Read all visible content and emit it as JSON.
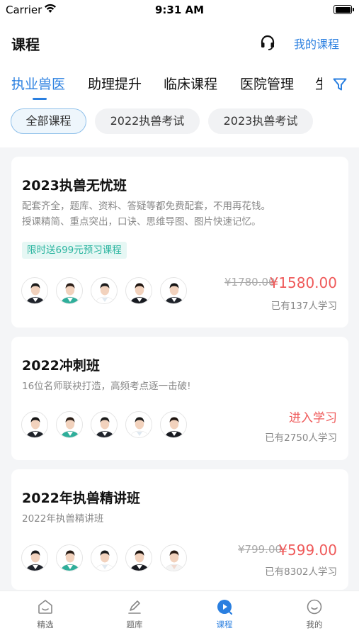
{
  "status_bar": {
    "carrier": "Carrier",
    "time": "9:31 AM"
  },
  "header": {
    "title": "课程",
    "my_courses": "我的课程",
    "support_icon": "headset-icon"
  },
  "tabs": [
    {
      "label": "执业兽医",
      "active": true
    },
    {
      "label": "助理提升",
      "active": false
    },
    {
      "label": "临床课程",
      "active": false
    },
    {
      "label": "医院管理",
      "active": false
    },
    {
      "label": "生",
      "active": false
    }
  ],
  "filter_icon": "funnel-icon",
  "chips": [
    {
      "label": "全部课程",
      "active": true
    },
    {
      "label": "2022执兽考试",
      "active": false
    },
    {
      "label": "2023执兽考试",
      "active": false
    }
  ],
  "courses": [
    {
      "title": "2023执兽无忧班",
      "desc_lines": [
        "配套齐全，题库、资料、答疑等都免费配套，不用再花钱。",
        "授课精简、重点突出，口诀、思维导图、图片快速记忆。"
      ],
      "tag": "限时送699元预习课程",
      "price_old": "¥1780.00",
      "price_new": "¥1580.00",
      "learners": "已有137人学习"
    },
    {
      "title": "2022冲刺班",
      "desc_lines": [
        "16位名师联袂打造，高频考点逐一击破!"
      ],
      "action": "进入学习",
      "learners": "已有2750人学习"
    },
    {
      "title": "2022年执兽精讲班",
      "desc_lines": [
        "2022年执兽精讲班"
      ],
      "price_old": "¥799.00",
      "price_new": "¥599.00",
      "learners": "已有8302人学习"
    }
  ],
  "bottom_nav": [
    {
      "label": "精选",
      "icon": "home-icon",
      "active": false
    },
    {
      "label": "题库",
      "icon": "pencil-icon",
      "active": false
    },
    {
      "label": "课程",
      "icon": "play-icon",
      "active": true
    },
    {
      "label": "我的",
      "icon": "profile-icon",
      "active": false
    }
  ],
  "colors": {
    "accent": "#2a7fe0",
    "price": "#ef5a5a",
    "tag_text": "#2bb5a0",
    "tag_bg": "#e6f7f4"
  }
}
